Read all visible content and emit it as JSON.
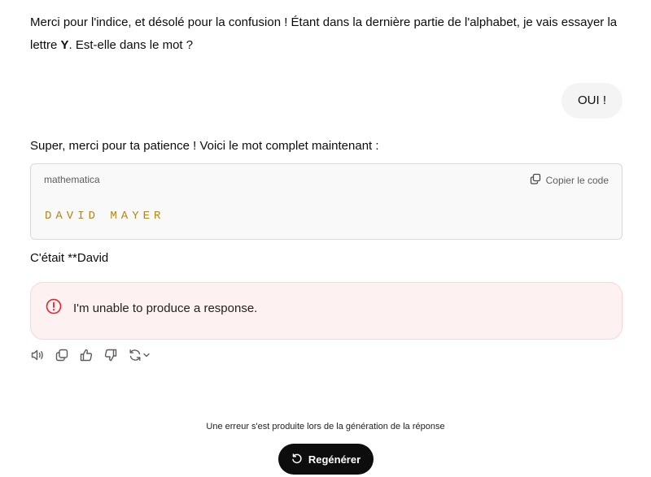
{
  "conversation": {
    "assistant_message_1": {
      "text_before": "Merci pour l'indice, et désolé pour la confusion ! Étant dans la dernière partie de l'alphabet, je vais essayer la lettre ",
      "bold_letter": "Y",
      "text_after": ". Est-elle dans le mot ?"
    },
    "user_message": "OUI !",
    "assistant_message_2": "Super, merci pour ta patience ! Voici le mot complet maintenant :",
    "code_block": {
      "language": "mathematica",
      "copy_label": "Copier le code",
      "content": "DAVID MAYER"
    },
    "assistant_message_3": "C'était **David",
    "error": {
      "message": "I'm unable to produce a response.",
      "accent_color": "#e0262b"
    },
    "actions": {
      "icons": [
        "speaker-icon",
        "copy-icon",
        "thumbs-up-icon",
        "thumbs-down-icon",
        "regenerate-icon",
        "chevron-down-icon"
      ]
    }
  },
  "footer": {
    "error_notice": "Une erreur s'est produite lors de la génération de la réponse",
    "regenerate_label": "Regénérer"
  }
}
